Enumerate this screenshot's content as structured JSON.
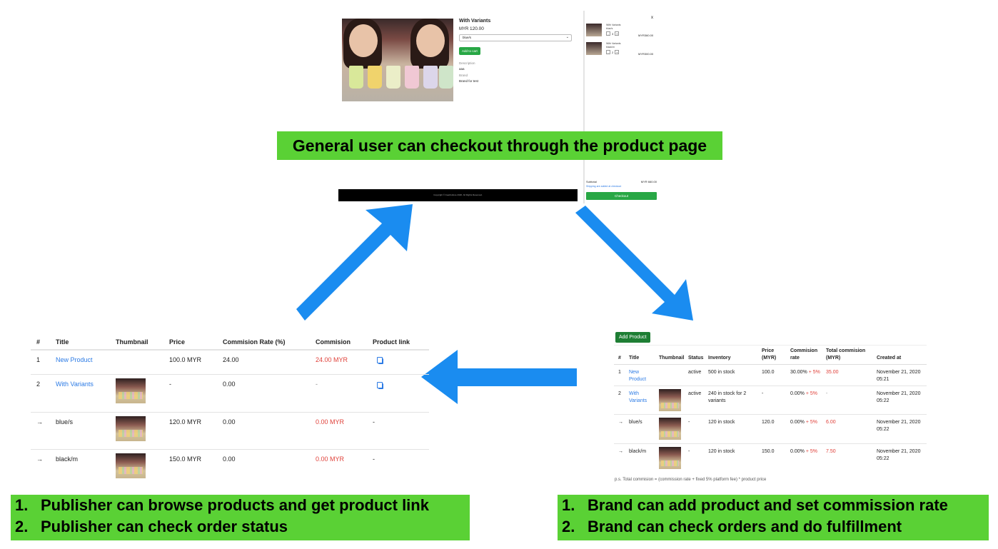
{
  "product_page": {
    "title": "With Variants",
    "price_currency": "MYR",
    "price_value": "120.00",
    "variant_selected": "blue/s",
    "add_to_cart": "Add to cart",
    "description_label": "Description",
    "description_value": "aaa",
    "brand_label": "Brand",
    "brand_value": "Brand for test",
    "cart_close": "x",
    "cart_items": [
      {
        "name": "With Variants",
        "variant": "blue/s",
        "qty": "3",
        "total": "MYR360.00"
      },
      {
        "name": "With Variants",
        "variant": "black/m",
        "qty": "2",
        "total": "MYR300.00"
      }
    ],
    "footer_copyright": "Copyright © FeatCulture 2020. All Rights Reserved.",
    "subtotal_label": "Subtotal",
    "subtotal_value": "MYR 660.00",
    "shipping_note": "Shipping are added at checkout",
    "checkout": "Checkout"
  },
  "banners": {
    "top": "General user can checkout through the product page",
    "left": [
      {
        "num": "1.",
        "text": "Publisher can browse products and get product link"
      },
      {
        "num": "2.",
        "text": "Publisher can check order status"
      }
    ],
    "right": [
      {
        "num": "1.",
        "text": "Brand can add product and set commission rate"
      },
      {
        "num": "2.",
        "text": "Brand can check orders and do fulfillment"
      }
    ]
  },
  "publisher_table": {
    "headers": [
      "#",
      "Title",
      "Thumbnail",
      "Price",
      "Commision Rate (%)",
      "Commision",
      "Product link"
    ],
    "rows": [
      {
        "num": "1",
        "title": "New Product",
        "price": "100.0 MYR",
        "rate": "24.00",
        "commission": "24.00 MYR",
        "link": "copy"
      },
      {
        "num": "2",
        "title": "With Variants",
        "price": "-",
        "rate": "0.00",
        "commission": "-",
        "link": "copy"
      },
      {
        "num": "→",
        "title": "blue/s",
        "price": "120.0 MYR",
        "rate": "0.00",
        "commission": "0.00 MYR",
        "link": "-"
      },
      {
        "num": "→",
        "title": "black/m",
        "price": "150.0 MYR",
        "rate": "0.00",
        "commission": "0.00 MYR",
        "link": "-"
      }
    ]
  },
  "brand_table": {
    "add_product": "Add Product",
    "headers": {
      "num": "#",
      "title": "Title",
      "thumbnail": "Thumbnail",
      "status": "Status",
      "inventory": "Inventory",
      "price_l1": "Price",
      "price_l2": "(MYR)",
      "rate_l1": "Commision",
      "rate_l2": "rate",
      "total_l1": "Total commision",
      "total_l2": "(MYR)",
      "created": "Created at"
    },
    "rows": [
      {
        "num": "1",
        "title_l1": "New",
        "title_l2": "Product",
        "status": "active",
        "inv_l1": "500 in stock",
        "inv_l2": "",
        "price": "100.0",
        "rate": "30.00%",
        "fee": "+ 5%",
        "total": "35.00",
        "date": "November 21, 2020",
        "time": "05:21"
      },
      {
        "num": "2",
        "title_l1": "With",
        "title_l2": "Variants",
        "status": "active",
        "inv_l1": "240 in stock for 2",
        "inv_l2": "variants",
        "price": "-",
        "rate": "0.00%",
        "fee": "+ 5%",
        "total": "-",
        "date": "November 21, 2020",
        "time": "05:22"
      },
      {
        "num": "→",
        "title_l1": "blue/s",
        "title_l2": "",
        "status": "-",
        "inv_l1": "120 in stock",
        "inv_l2": "",
        "price": "120.0",
        "rate": "0.00%",
        "fee": "+ 5%",
        "total": "6.00",
        "date": "November 21, 2020",
        "time": "05:22"
      },
      {
        "num": "→",
        "title_l1": "black/m",
        "title_l2": "",
        "status": "-",
        "inv_l1": "120 in stock",
        "inv_l2": "",
        "price": "150.0",
        "rate": "0.00%",
        "fee": "+ 5%",
        "total": "7.50",
        "date": "November 21, 2020",
        "time": "05:22"
      }
    ],
    "footnote": "p.s. Total commision = (commission rate + fixed 5% platform fee) * product price"
  },
  "colors": {
    "banner": "#5ad135",
    "arrow": "#1a8cf0",
    "link": "#2c7be5",
    "red": "#e0423b",
    "button_green": "#28a745"
  }
}
